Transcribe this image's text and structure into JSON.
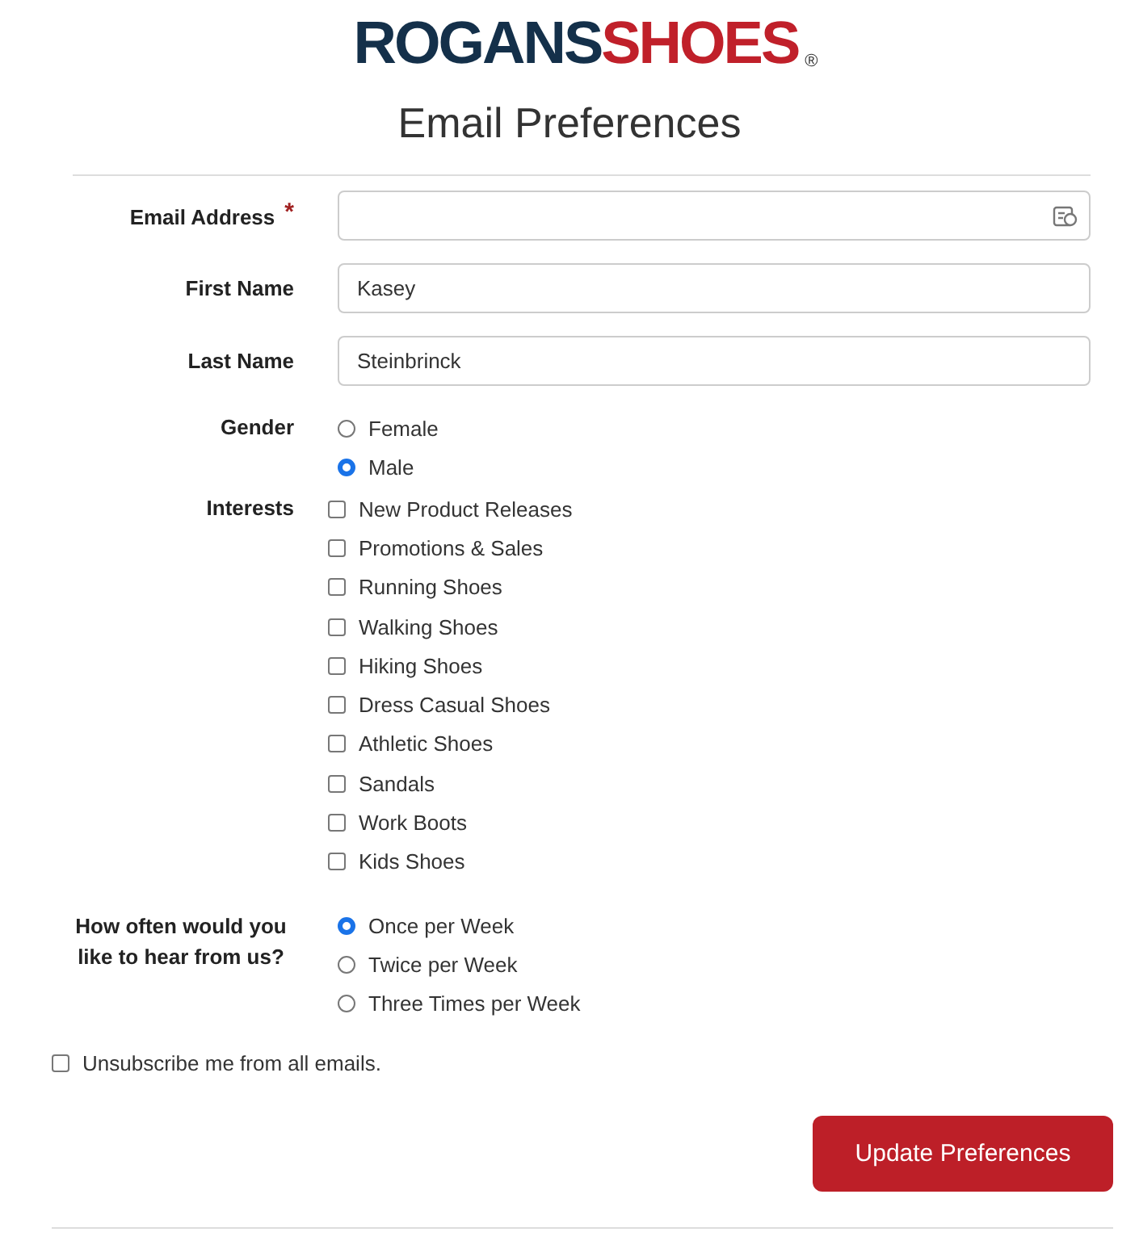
{
  "logo": {
    "part_1": "ROGANS",
    "part_2": "SHOES",
    "mark": "®"
  },
  "title": "Email Preferences",
  "fields": [
    {
      "label": "Email Address",
      "required_mark": "*",
      "has_icon": true
    },
    {
      "label": "First Name",
      "value": "Kasey",
      "has_icon": false
    },
    {
      "label": "Last Name",
      "value": "Steinbrinck",
      "has_icon": false
    }
  ],
  "gender": {
    "label": "Gender",
    "options": [
      {
        "label": "Female",
        "selected": false
      },
      {
        "label": "Male",
        "selected": true
      }
    ]
  },
  "interests": {
    "label": "Interests",
    "options": [
      {
        "label": "New Product Releases",
        "checked": false
      },
      {
        "label": "Promotions & Sales",
        "checked": false
      },
      {
        "label": "Running Shoes",
        "checked": false
      },
      {
        "label": "Walking Shoes",
        "checked": false
      },
      {
        "label": "Hiking Shoes",
        "checked": false
      },
      {
        "label": "Dress Casual Shoes",
        "checked": false
      },
      {
        "label": "Athletic Shoes",
        "checked": false
      },
      {
        "label": "Sandals",
        "checked": false
      },
      {
        "label": "Work Boots",
        "checked": false
      },
      {
        "label": "Kids Shoes",
        "checked": false
      }
    ]
  },
  "frequency": {
    "label": "How often would you like to hear from us?",
    "options": [
      {
        "label": "Once per Week",
        "selected": true
      },
      {
        "label": "Twice per Week",
        "selected": false
      },
      {
        "label": "Three Times per Week",
        "selected": false
      }
    ]
  },
  "unsubscribe": {
    "label": "Unsubscribe me from all emails.",
    "checked": false
  },
  "submit_button": "Update Preferences"
}
